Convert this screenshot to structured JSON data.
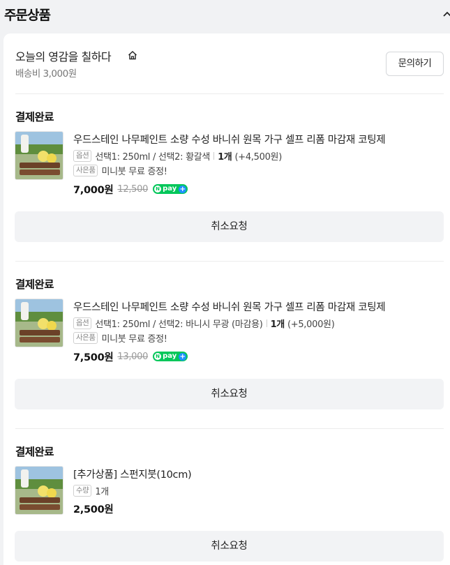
{
  "header": {
    "title": "주문상품"
  },
  "store": {
    "name": "오늘의 영감을 칠하다",
    "shipping_fee": "배송비 3,000원",
    "inquiry_label": "문의하기"
  },
  "orders": [
    {
      "status": "결제완료",
      "product_name": "우드스테인 나무페인트 소량 수성 바니쉬 원목 가구 셀프 리폼 마감재 코팅제",
      "option_tag": "옵션",
      "option_text": "선택1: 250ml / 선택2: 황갈색",
      "quantity": "1개",
      "option_price": "(+4,500원)",
      "gift_tag": "사은품",
      "gift_text": "미니붓 무료 증정!",
      "price": "7,000원",
      "original_price": "12,500",
      "npay_label": "pay",
      "cancel_label": "취소요청"
    },
    {
      "status": "결제완료",
      "product_name": "우드스테인 나무페인트 소량 수성 바니쉬 원목 가구 셀프 리폼 마감재 코팅제",
      "option_tag": "옵션",
      "option_text": "선택1: 250ml / 선택2: 바니시 무광 (마감용)",
      "quantity": "1개",
      "option_price": "(+5,000원)",
      "gift_tag": "사은품",
      "gift_text": "미니붓 무료 증정!",
      "price": "7,500원",
      "original_price": "13,000",
      "npay_label": "pay",
      "cancel_label": "취소요청"
    },
    {
      "status": "결제완료",
      "product_name": "[추가상품] 스펀지붓(10cm)",
      "qty_tag": "수량",
      "quantity": "1개",
      "price": "2,500원",
      "cancel_label": "취소요청"
    }
  ],
  "colors": {
    "npay_green": "#03c75a",
    "button_bg": "#f2f3f5",
    "page_bg": "#f1f2f4"
  }
}
